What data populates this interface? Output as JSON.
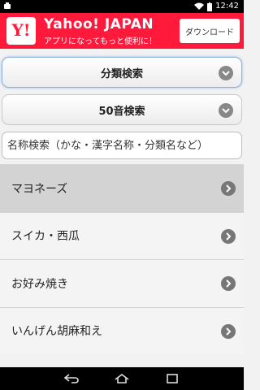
{
  "status_bar": {
    "time": "12:42",
    "icons": [
      "android-notification-icon",
      "wifi-icon",
      "battery-icon"
    ]
  },
  "ad_banner": {
    "logo_text": "Y!",
    "title": "Yahoo! JAPAN",
    "subtitle": "アプリになってもっと便利に！",
    "download_label": "ダウンロード",
    "brand_color": "#ff1a3c"
  },
  "filters": {
    "category_search_label": "分類検索",
    "kana_search_label": "50音検索"
  },
  "search": {
    "placeholder": "名称検索（かな・漢字名称・分類名など）"
  },
  "list": {
    "items": [
      {
        "label": "マヨネーズ"
      },
      {
        "label": "スイカ・西瓜"
      },
      {
        "label": "お好み焼き"
      },
      {
        "label": "いんげん胡麻和え"
      }
    ]
  },
  "nav_bar": {
    "icons": [
      "back-icon",
      "home-icon",
      "recents-icon"
    ]
  }
}
